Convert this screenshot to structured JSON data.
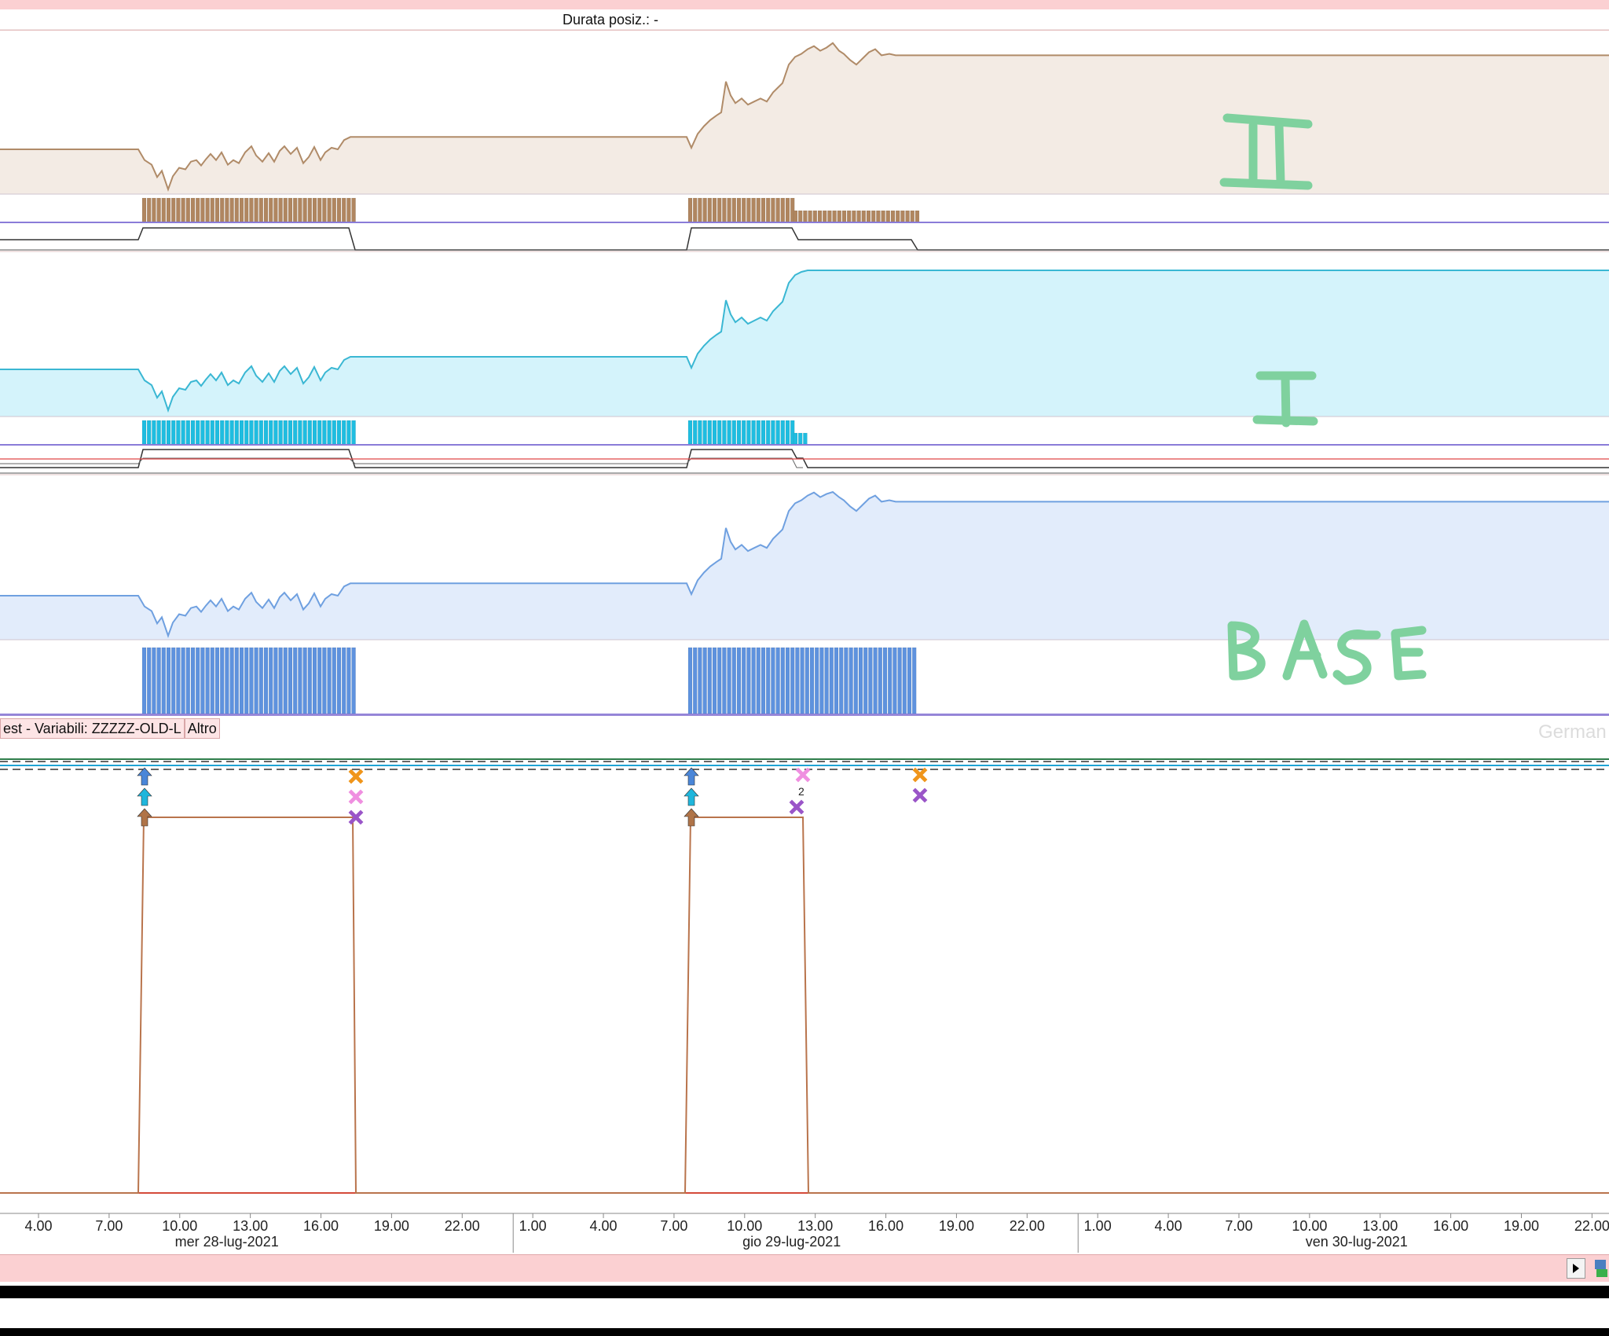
{
  "header": {
    "title": "Durata posiz.: -"
  },
  "panels": {
    "upper_label": "II",
    "middle_label": "I",
    "lower_label": "BASE"
  },
  "section": {
    "label": "est - Variabili: ZZZZZ-OLD-L",
    "tab": "Altro",
    "watermark": "German"
  },
  "colors": {
    "panel2_fill": "#f3ebe4",
    "panel2_line": "#b08b68",
    "panel2_bars": "#b08660",
    "panel1_fill": "#d4f3fb",
    "panel1_line": "#3ab7d3",
    "panel1_bars": "#1fbde0",
    "base_fill": "#e2ecfb",
    "base_line": "#6fa0e0",
    "base_bars": "#5e92de",
    "handwriting": "#7fd19e",
    "position_line": "#b9744c",
    "baseline": "#d44a3a",
    "up_arrow_blue": "#4a86d8",
    "up_arrow_cyan": "#1fb6dc",
    "up_arrow_brown": "#b07448",
    "x_orange": "#f0951a",
    "x_pink": "#ef8fe0",
    "x_purple": "#9a55c8"
  },
  "chart_data": {
    "type": "line",
    "x_axis": {
      "tick_labels": [
        "4.00",
        "7.00",
        "10.00",
        "13.00",
        "16.00",
        "19.00",
        "22.00",
        "1.00",
        "4.00",
        "7.00",
        "10.00",
        "13.00",
        "16.00",
        "19.00",
        "22.00",
        "1.00",
        "4.00",
        "7.00",
        "10.00",
        "13.00",
        "16.00",
        "19.00",
        "22.00"
      ],
      "tick_hours": [
        4,
        7,
        10,
        13,
        16,
        19,
        22,
        25,
        28,
        31,
        34,
        37,
        40,
        43,
        46,
        49,
        52,
        55,
        58,
        61,
        64,
        67,
        70
      ],
      "date_labels": [
        "mer 28-lug-2021",
        "gio 29-lug-2021",
        "ven 30-lug-2021"
      ],
      "date_centers_hours": [
        12,
        36,
        60
      ],
      "day_separators_hours": [
        24,
        48
      ],
      "range_hours": [
        2.4,
        70.2
      ]
    },
    "series": [
      {
        "name": "II",
        "panel": "upper"
      },
      {
        "name": "I",
        "panel": "middle"
      },
      {
        "name": "BASE",
        "panel": "lower"
      }
    ],
    "position_intervals": [
      {
        "start": 8.4,
        "end": 17.6,
        "type": "long"
      },
      {
        "start": 31.6,
        "end": 36.3,
        "type": "long"
      },
      {
        "start": 36.3,
        "end": 41.3,
        "type": "long_reduced"
      }
    ]
  }
}
